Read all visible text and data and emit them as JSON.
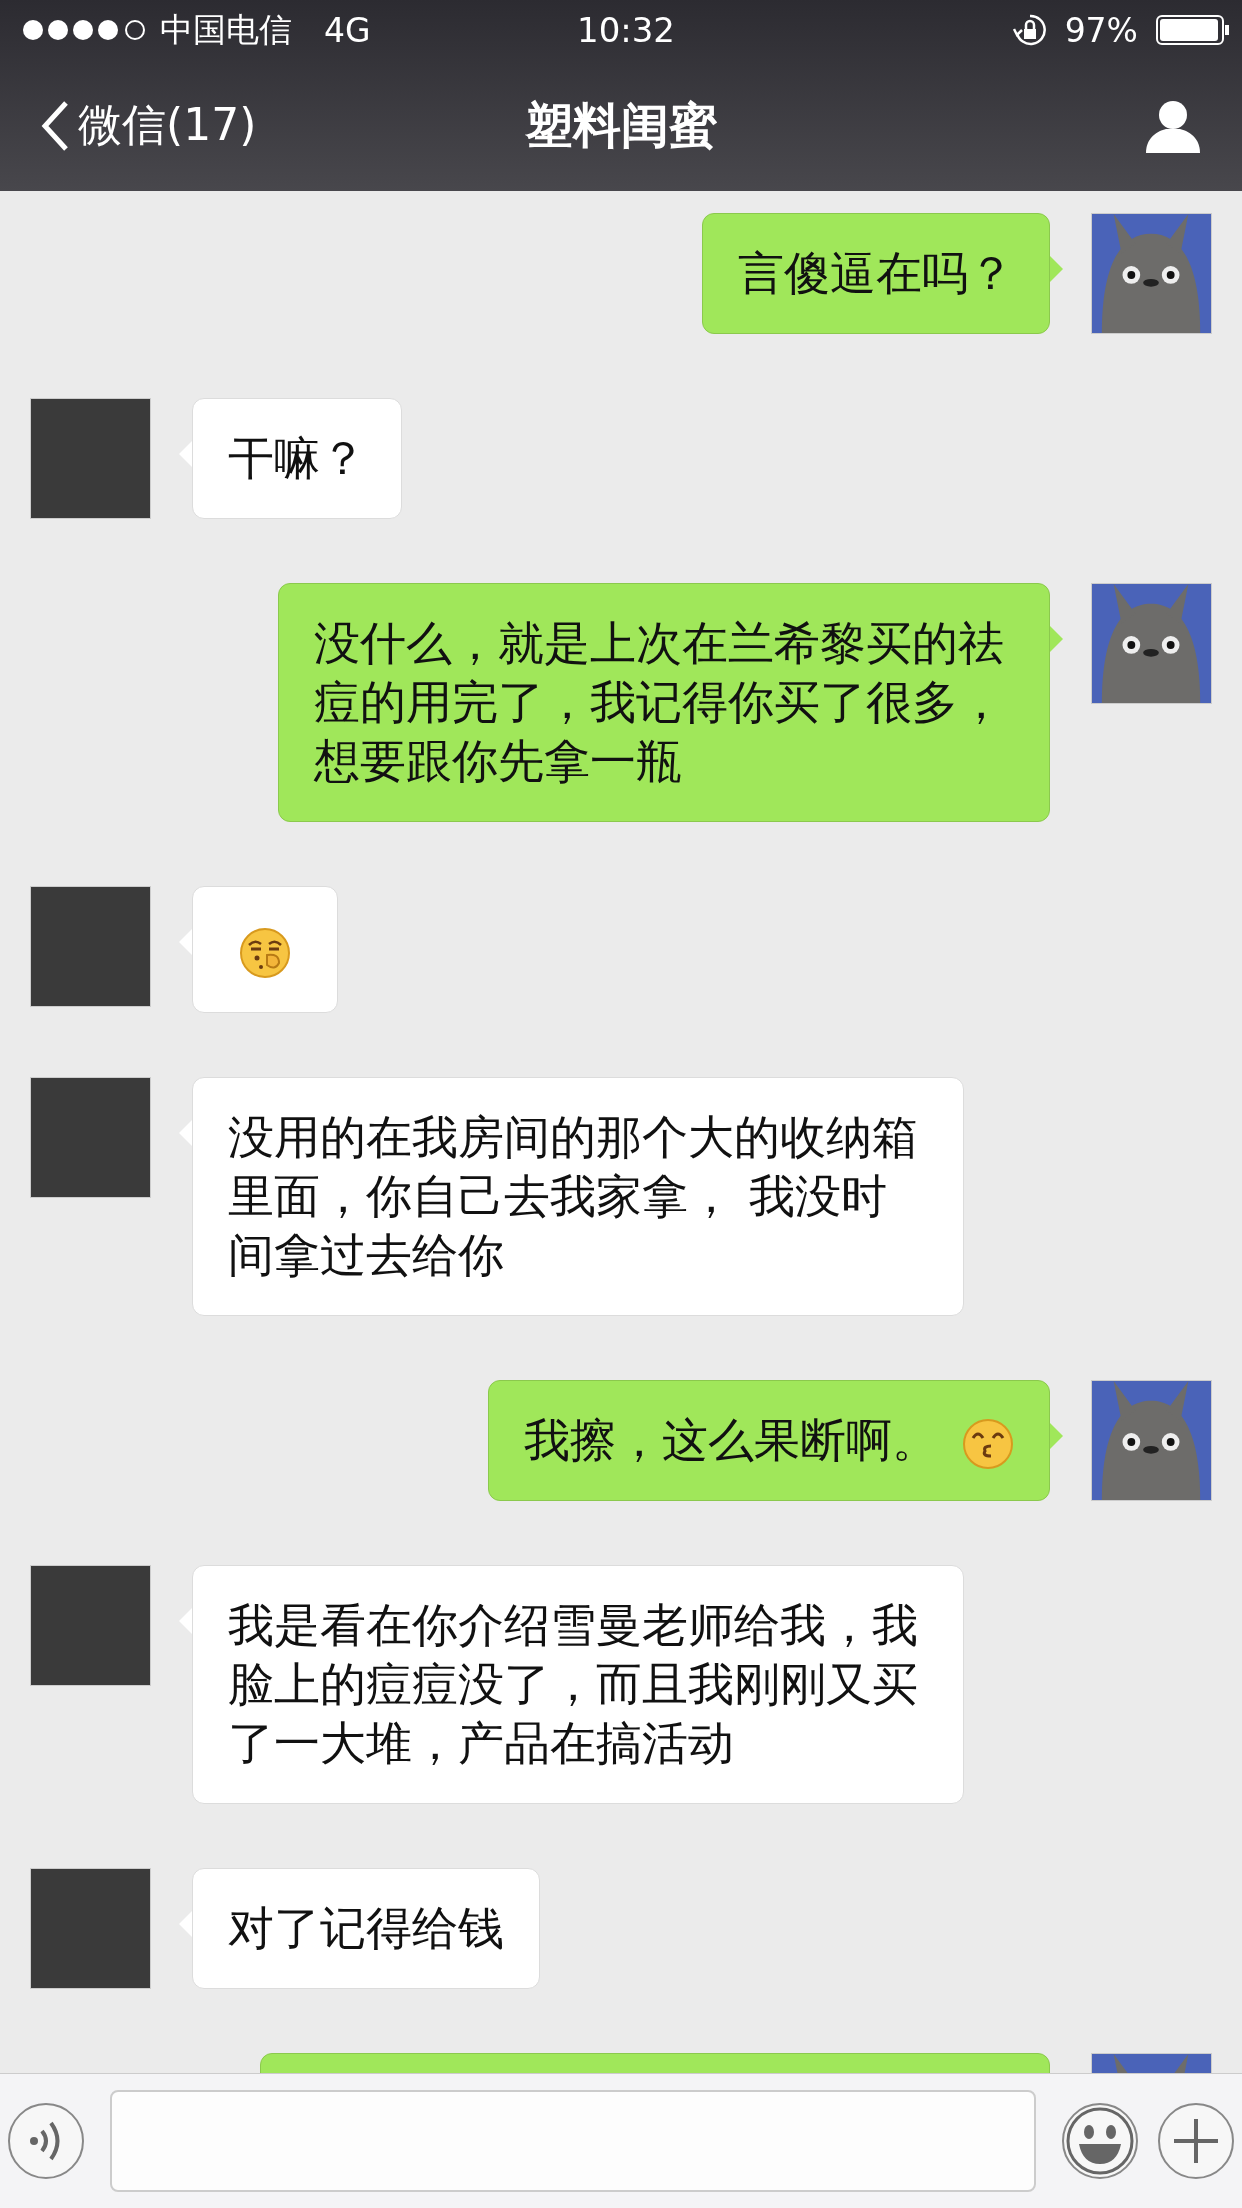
{
  "status_bar": {
    "carrier": "中国电信",
    "network": "4G",
    "time": "10:32",
    "battery": "97%"
  },
  "nav": {
    "back": "微信(17)",
    "title": "塑料闺蜜"
  },
  "messages": [
    {
      "sent": true,
      "kind": "text",
      "text": "言傻逼在吗？"
    },
    {
      "sent": false,
      "kind": "text",
      "text": "干嘛？"
    },
    {
      "sent": true,
      "kind": "text",
      "text": "没什么，就是上次在兰希黎买的祛痘的用完了，我记得你买了很多，想要跟你先拿一瓶"
    },
    {
      "sent": false,
      "kind": "emoji"
    },
    {
      "sent": false,
      "kind": "text",
      "text": "没用的在我房间的那个大的收纳箱里面，你自己去我家拿， 我没时间拿过去给你"
    },
    {
      "sent": true,
      "kind": "text_emoji",
      "text": "我擦，这么果断啊。"
    },
    {
      "sent": false,
      "kind": "text",
      "text": "我是看在你介绍雪曼老师给我，我脸上的痘痘没了，而且我刚刚又买了一大堆，产品在搞活动"
    },
    {
      "sent": false,
      "kind": "text",
      "text": "对了记得给钱"
    },
    {
      "sent": true,
      "kind": "partial"
    }
  ]
}
